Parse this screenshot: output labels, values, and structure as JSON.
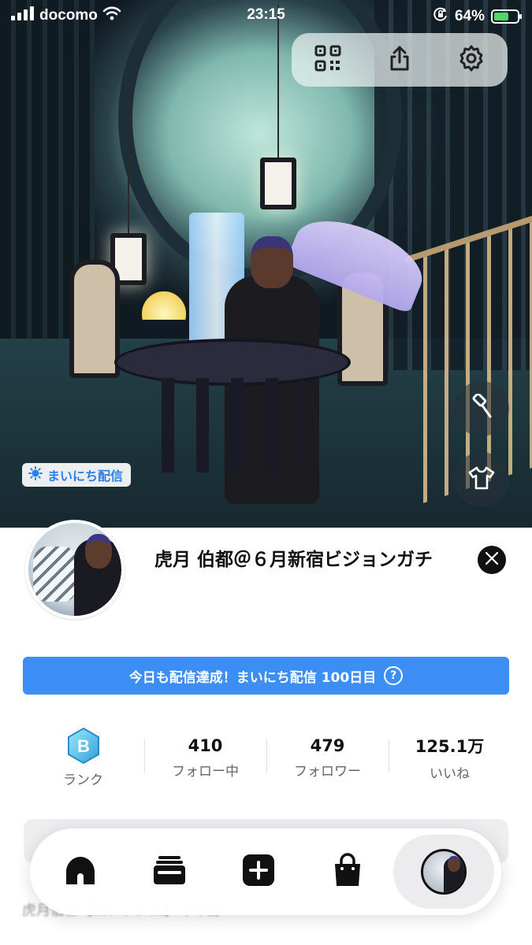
{
  "status_bar": {
    "carrier": "docomo",
    "time": "23:15",
    "battery": "64%",
    "battery_level": 0.64
  },
  "hero": {
    "daily_tag": "まいにち配信"
  },
  "profile": {
    "display_name": "虎月 伯都＠６月新宿ビジョンガチ"
  },
  "streak_banner": {
    "text": "今日も配信達成！まいにち配信 100日目"
  },
  "stats": {
    "rank_letter": "B",
    "rank_label": "ランク",
    "following_value": "410",
    "following_label": "フォロー中",
    "followers_value": "479",
    "followers_label": "フォロワー",
    "likes_value": "125.1万",
    "likes_label": "いいね"
  },
  "feed": {
    "ghost_title": "虎月伯都【ロンソノム】ママ初"
  },
  "colors": {
    "accent": "#3d8ef4",
    "rank_badge": "#4fb8e6",
    "battery_fill": "#4cd964"
  },
  "icons": {
    "qr": "qr-code-icon",
    "share": "share-icon",
    "settings": "gear-icon",
    "edit": "brush-icon",
    "closet": "tshirt-icon",
    "x": "x-logo-icon",
    "home": "home-icon",
    "archive": "archive-icon",
    "create": "plus-icon",
    "shop": "bag-icon"
  }
}
